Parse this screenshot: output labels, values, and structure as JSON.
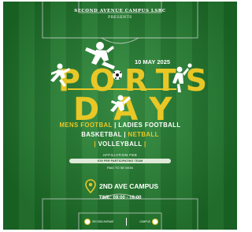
{
  "header": {
    "org": "SECOND AVENUE CAMPUS LSRC",
    "presents": "PRESENTS"
  },
  "event": {
    "date": "10 MAY 2025",
    "title_line1": "PORTS",
    "title_line2": "DAY"
  },
  "sports": {
    "row1": [
      "MENS FOOTBAL",
      "|",
      "LADIES FOOTBALL"
    ],
    "row2": [
      "BASKETBAL",
      "|",
      "NETBALL"
    ],
    "row3": [
      "|",
      "VOLLEYBALL",
      "|"
    ]
  },
  "fee": {
    "label": "AFFILIATION FEE",
    "value": "K50 PER PARTICIPATING TEAM",
    "note": "PAID TO SE WON"
  },
  "venue": {
    "name": "2ND AVE CAMPUS",
    "time": "TIME: 09:00 - 16:00"
  },
  "sponsors": [
    "SECOND AVENUE",
    "CAMPUS"
  ],
  "colors": {
    "grass_dark": "#1f7a2c",
    "grass_light": "#2a8a37",
    "accent_yellow": "#e8c726",
    "text_white": "#ffffff"
  }
}
